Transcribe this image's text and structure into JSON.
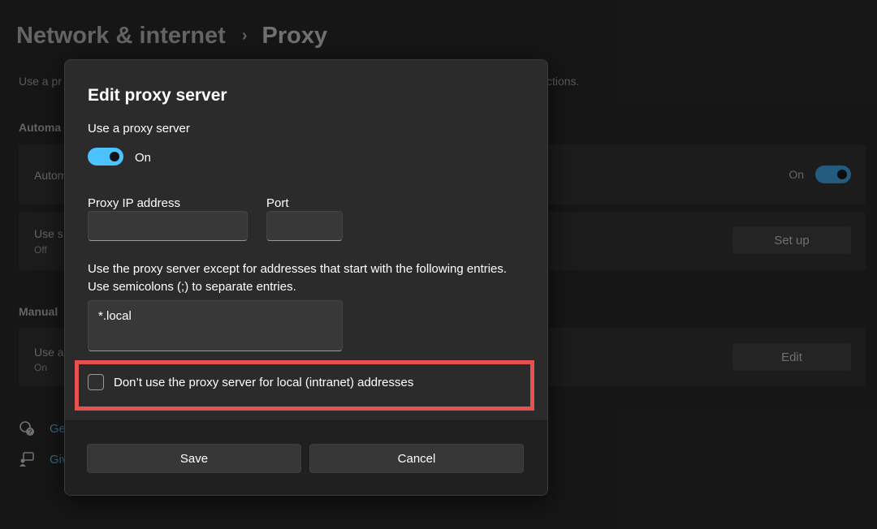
{
  "background": {
    "breadcrumb": {
      "parent": "Network & internet",
      "separator": "›",
      "current": "Proxy"
    },
    "description_left": "Use a pr",
    "description_right": "ctions.",
    "sections": {
      "automatic_title": "Automa",
      "manual_title": "Manual"
    },
    "cards": {
      "auto_detect": {
        "title": "Autom",
        "toggle_state": "On"
      },
      "setup_script": {
        "title": "Use s",
        "subtitle": "Off",
        "button_label": "Set up"
      },
      "manual_proxy": {
        "title": "Use a",
        "subtitle": "On",
        "button_label": "Edit"
      }
    },
    "links": {
      "get_help": "Ge",
      "give_feedback": "Giv"
    }
  },
  "dialog": {
    "title": "Edit proxy server",
    "use_proxy_label": "Use a proxy server",
    "use_proxy_toggle_state": "On",
    "proxy_ip_label": "Proxy IP address",
    "proxy_ip_value": "",
    "port_label": "Port",
    "port_value": "",
    "exceptions_instructions_line1": "Use the proxy server except for addresses that start with the following entries.",
    "exceptions_instructions_line2": "Use semicolons (;) to separate entries.",
    "exceptions_value": "*.local",
    "local_bypass_label": "Don’t use the proxy server for local (intranet) addresses",
    "local_bypass_checked": false,
    "save_label": "Save",
    "cancel_label": "Cancel"
  },
  "colors": {
    "accent": "#4cc2ff",
    "highlight": "#e5524f",
    "dialog_bg": "#2b2b2b",
    "footer_bg": "#202020"
  }
}
